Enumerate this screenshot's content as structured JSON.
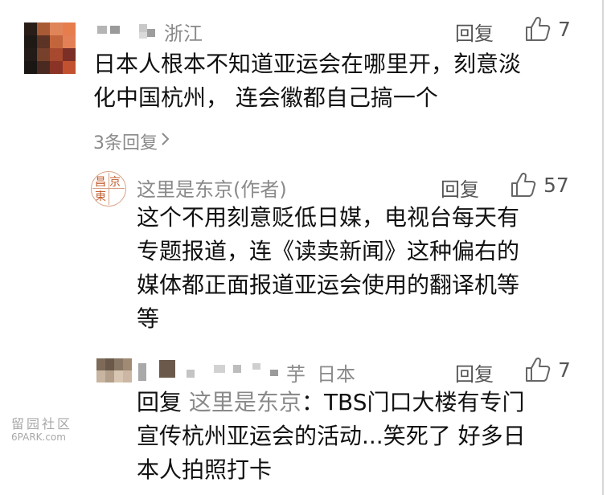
{
  "comments": [
    {
      "user_name_blurred": "▀ ▀",
      "location": "浙江",
      "reply_label": "回复",
      "like_count": "7",
      "text_line1": "日本人根本不知道亚运会在哪里开，刻意淡",
      "text_line2": "化中国杭州， 连会徽都自己搞一个",
      "replies_summary": "3条回复"
    },
    {
      "user_name": "这里是东京(作者)",
      "avatar_chars": [
        "昌",
        "京",
        "東",
        ""
      ],
      "reply_label": "回复",
      "like_count": "57",
      "text_line1": "这个不用刻意贬低日媒，电视台每天有",
      "text_line2": "专题报道，连《读卖新闻》这种偏右的",
      "text_line3": "媒体都正面报道亚运会使用的翻译机等",
      "text_line4": "等"
    },
    {
      "user_name_suffix": "芋",
      "location": "日本",
      "reply_label": "回复",
      "like_count": "7",
      "reply_prefix": "回复",
      "reply_target": "这里是东京",
      "text_line1": "：TBS门口大楼有专门",
      "text_line2": "宣传杭州亚运会的活动...笑死了 好多日",
      "text_line3": "本人拍照打卡"
    }
  ],
  "watermark": {
    "line1": "留园社区",
    "line2": "6PARK.com"
  },
  "colors": {
    "text": "#111111",
    "muted": "#888888",
    "divider": "#e6e6e6",
    "border": "#d7d7d7"
  }
}
